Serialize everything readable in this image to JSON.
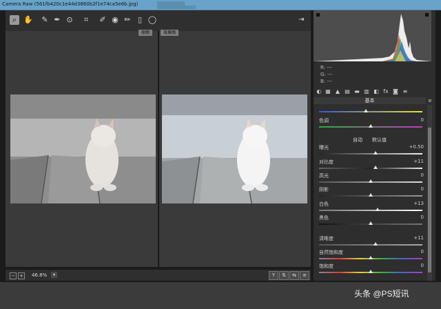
{
  "window": {
    "title": "Camera Raw (561fb420c1e44d3860b2f1e74ca5e6b.jpg)"
  },
  "toolbar": {
    "tools": [
      {
        "name": "zoom-tool",
        "glyph": "⌕"
      },
      {
        "name": "hand-tool",
        "glyph": "✋"
      },
      {
        "name": "white-balance-tool",
        "glyph": "✎"
      },
      {
        "name": "color-sampler-tool",
        "glyph": "✒"
      },
      {
        "name": "targeted-adjust-tool",
        "glyph": "⊙"
      },
      {
        "name": "crop-tool",
        "glyph": "⌗"
      },
      {
        "name": "spot-removal-tool",
        "glyph": "✐"
      },
      {
        "name": "red-eye-tool",
        "glyph": "◉"
      },
      {
        "name": "adjustment-brush-tool",
        "glyph": "✏"
      },
      {
        "name": "graduated-filter-tool",
        "glyph": "▯"
      },
      {
        "name": "radial-filter-tool",
        "glyph": "◯"
      }
    ],
    "open_preferences_glyph": "⇥"
  },
  "preview": {
    "before_label": "原图",
    "after_label": "效果图"
  },
  "status": {
    "zoom": "46.8%",
    "zoom_dropdown": "▾",
    "minus": "−",
    "plus": "+"
  },
  "view_buttons": [
    "Y",
    "⇅",
    "⇆",
    "≡"
  ],
  "histogram": {
    "r": "R:  ---",
    "g": "G:  ---",
    "b": "B:  ---"
  },
  "panel_tabs": [
    "◐",
    "▦",
    "▲",
    "▤",
    "▬",
    "▥",
    "◧",
    "fx",
    "◙",
    "≡"
  ],
  "basic": {
    "header": "基本",
    "menu": "≡",
    "auto_label": "自动",
    "default_label": "默认值",
    "sliders": [
      {
        "label": "色调",
        "value": "0",
        "pos": 0.5
      },
      {
        "label": "曝光",
        "value": "+0.50",
        "pos": 0.55
      },
      {
        "label": "对比度",
        "value": "+11",
        "pos": 0.55
      },
      {
        "label": "高光",
        "value": "0",
        "pos": 0.5
      },
      {
        "label": "阴影",
        "value": "0",
        "pos": 0.5
      },
      {
        "label": "白色",
        "value": "+13",
        "pos": 0.56
      },
      {
        "label": "黑色",
        "value": "0",
        "pos": 0.5
      },
      {
        "label": "清晰度",
        "value": "+11",
        "pos": 0.55
      },
      {
        "label": "自然饱和度",
        "value": "0",
        "pos": 0.5
      },
      {
        "label": "饱和度",
        "value": "0",
        "pos": 0.5
      }
    ]
  },
  "watermark": "头条 @PS短讯"
}
